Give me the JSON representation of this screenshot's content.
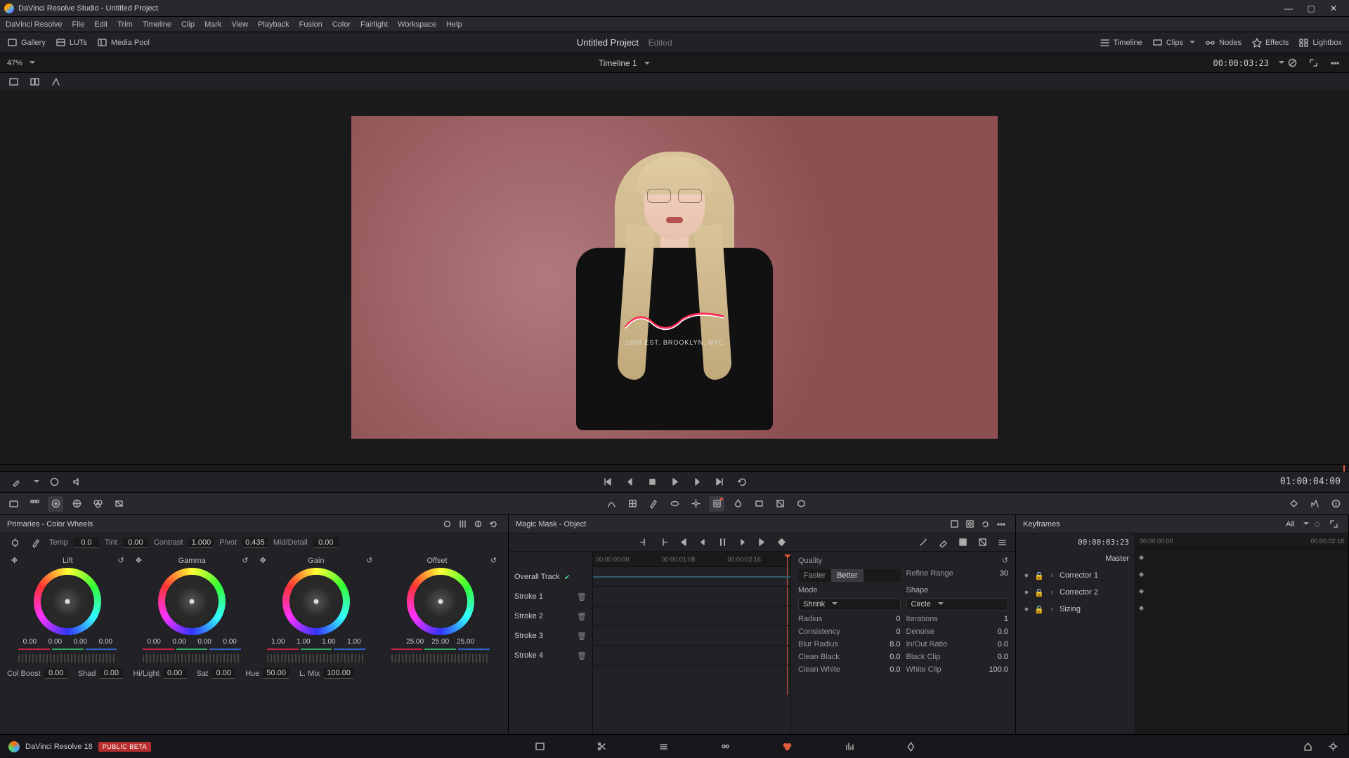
{
  "app": {
    "title": "DaVinci Resolve Studio - Untitled Project",
    "name": "DaVinci Resolve 18",
    "beta": "PUBLIC BETA"
  },
  "menu": [
    "DaVinci Resolve",
    "File",
    "Edit",
    "Trim",
    "Timeline",
    "Clip",
    "Mark",
    "View",
    "Playback",
    "Fusion",
    "Color",
    "Fairlight",
    "Workspace",
    "Help"
  ],
  "toolbar": {
    "gallery": "Gallery",
    "luts": "LUTs",
    "mediapool": "Media Pool",
    "project": "Untitled Project",
    "edited": "Edited",
    "timeline": "Timeline",
    "clips": "Clips",
    "nodes": "Nodes",
    "effects": "Effects",
    "lightbox": "Lightbox"
  },
  "viewer": {
    "zoom": "47%",
    "timeline_name": "Timeline 1",
    "timecode": "00:00:03:23",
    "shirt_text": "1989 EST. BROOKLYN, NYC"
  },
  "transport": {
    "timecode": "01:00:04:00"
  },
  "primaries": {
    "title": "Primaries - Color Wheels",
    "adjust": {
      "temp_l": "Temp",
      "temp": "0.0",
      "tint_l": "Tint",
      "tint": "0.00",
      "contrast_l": "Contrast",
      "contrast": "1.000",
      "pivot_l": "Pivot",
      "pivot": "0.435",
      "md_l": "Mid/Detail",
      "md": "0.00"
    },
    "wheels": [
      {
        "name": "Lift",
        "vals": [
          "0.00",
          "0.00",
          "0.00",
          "0.00"
        ]
      },
      {
        "name": "Gamma",
        "vals": [
          "0.00",
          "0.00",
          "0.00",
          "0.00"
        ]
      },
      {
        "name": "Gain",
        "vals": [
          "1.00",
          "1.00",
          "1.00",
          "1.00"
        ]
      },
      {
        "name": "Offset",
        "vals": [
          "25.00",
          "25.00",
          "25.00"
        ]
      }
    ],
    "adjust2": {
      "colboost_l": "Col Boost",
      "colboost": "0.00",
      "shad_l": "Shad",
      "shad": "0.00",
      "hilight_l": "Hi/Light",
      "hilight": "0.00",
      "sat_l": "Sat",
      "sat": "0.00",
      "hue_l": "Hue",
      "hue": "50.00",
      "lmix_l": "L. Mix",
      "lmix": "100.00"
    }
  },
  "magicmask": {
    "title": "Magic Mask - Object",
    "strokes": [
      "Overall Track",
      "Stroke 1",
      "Stroke 2",
      "Stroke 3",
      "Stroke 4"
    ],
    "ruler": [
      "00:00:00:00",
      "00:00:01:08",
      "00:00:02:16"
    ],
    "quality_l": "Quality",
    "faster": "Faster",
    "better": "Better",
    "refine_l": "Refine Range",
    "refine": "30",
    "mode_l": "Mode",
    "mode": "Shrink",
    "shape_l": "Shape",
    "shape": "Circle",
    "radius_l": "Radius",
    "radius": "0",
    "iter_l": "Iterations",
    "iter": "1",
    "consist_l": "Consistency",
    "consist": "0",
    "denoise_l": "Denoise",
    "denoise": "0.0",
    "blur_l": "Blur Radius",
    "blur": "8.0",
    "inout_l": "In/Out Ratio",
    "inout": "0.0",
    "cblack_l": "Clean Black",
    "cblack": "0.0",
    "bclip_l": "Black Clip",
    "bclip": "0.0",
    "cwhite_l": "Clean White",
    "cwhite": "0.0",
    "wclip_l": "White Clip",
    "wclip": "100.0"
  },
  "keyframes": {
    "title": "Keyframes",
    "all": "All",
    "timecode": "00:00:03:23",
    "ruler": [
      "00:00:00:00",
      "00:00:02:18"
    ],
    "rows": [
      "Master",
      "Corrector 1",
      "Corrector 2",
      "Sizing"
    ]
  }
}
